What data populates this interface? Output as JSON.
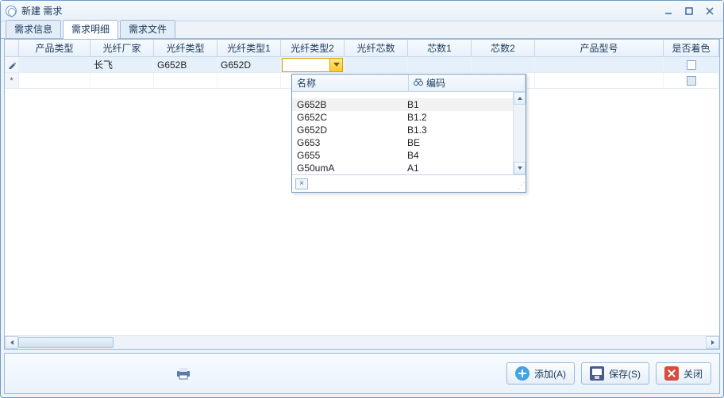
{
  "window": {
    "title": "新建 需求"
  },
  "tabs": [
    {
      "label": "需求信息",
      "active": false
    },
    {
      "label": "需求明细",
      "active": true
    },
    {
      "label": "需求文件",
      "active": false
    }
  ],
  "grid": {
    "columns": [
      "产品类型",
      "光纤厂家",
      "光纤类型",
      "光纤类型1",
      "光纤类型2",
      "光纤芯数",
      "芯数1",
      "芯数2",
      "产品型号",
      "是否着色"
    ],
    "rows": [
      {
        "indicator": "edit",
        "产品类型": "",
        "光纤厂家": "长飞",
        "光纤类型": "G652B",
        "光纤类型1": "G652D",
        "光纤类型2": "",
        "光纤芯数": "",
        "芯数1": "",
        "芯数2": "",
        "产品型号": "",
        "是否着色": false
      },
      {
        "indicator": "new",
        "产品类型": "",
        "光纤厂家": "",
        "光纤类型": "",
        "光纤类型1": "",
        "光纤类型2": "",
        "光纤芯数": "",
        "芯数1": "",
        "芯数2": "",
        "产品型号": "",
        "是否着色": false
      }
    ],
    "editing": {
      "row": 0,
      "column": "光纤类型2"
    }
  },
  "dropdown": {
    "headers": {
      "name": "名称",
      "code": "编码"
    },
    "selected_index": 0,
    "options": [
      {
        "name": "G652B",
        "code": "B1"
      },
      {
        "name": "G652C",
        "code": "B1.2"
      },
      {
        "name": "G652D",
        "code": "B1.3"
      },
      {
        "name": "G653",
        "code": "BE"
      },
      {
        "name": "G655",
        "code": "B4"
      },
      {
        "name": "G50umA",
        "code": "A1"
      }
    ]
  },
  "footer": {
    "buttons": {
      "add": "添加(A)",
      "save": "保存(S)",
      "close": "关闭"
    }
  }
}
